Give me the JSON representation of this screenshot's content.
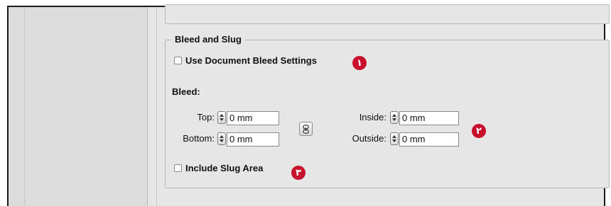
{
  "section": {
    "title": "Bleed and Slug"
  },
  "use_document_bleed": {
    "label": "Use Document Bleed Settings",
    "checked": false
  },
  "bleed": {
    "heading": "Bleed:",
    "top_label": "Top:",
    "top_value": "0 mm",
    "bottom_label": "Bottom:",
    "bottom_value": "0 mm",
    "inside_label": "Inside:",
    "inside_value": "0 mm",
    "outside_label": "Outside:",
    "outside_value": "0 mm",
    "link_icon": "chain-link-icon"
  },
  "slug": {
    "label": "Include Slug Area",
    "checked": false
  },
  "callouts": {
    "one": "١",
    "two": "٢",
    "three": "٣",
    "color": "#c8102e"
  }
}
